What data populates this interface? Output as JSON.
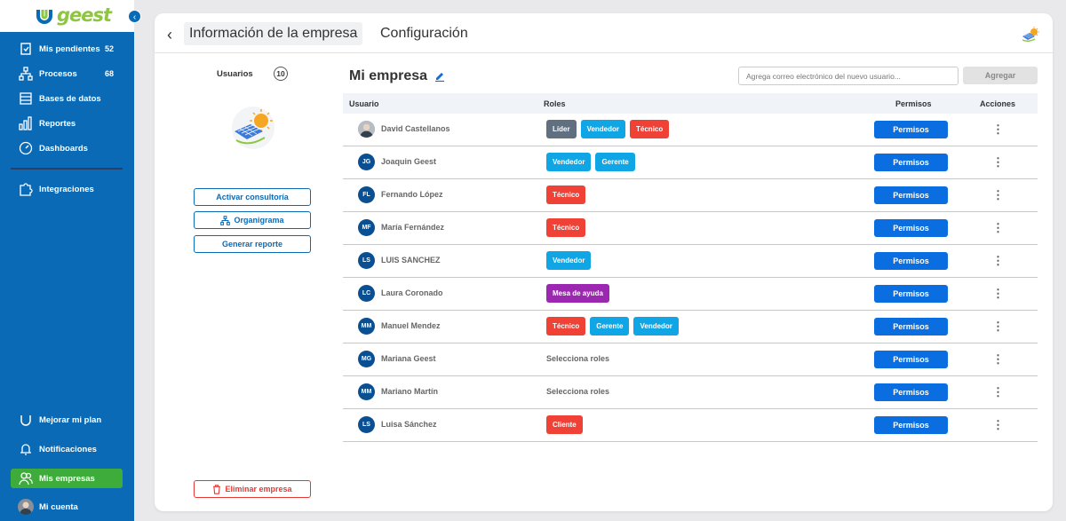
{
  "app": {
    "brand": "geest",
    "brand_color": "#8ec641",
    "sidebar_color": "#0a6ab5",
    "active_color": "#3dac3a"
  },
  "sidebar": {
    "items": [
      {
        "label": "Mis pendientes",
        "count": "52",
        "icon": "clipboard-icon"
      },
      {
        "label": "Procesos",
        "count": "68",
        "icon": "process-tree-icon"
      },
      {
        "label": "Bases de datos",
        "icon": "database-icon"
      },
      {
        "label": "Reportes",
        "icon": "bar-chart-icon"
      },
      {
        "label": "Dashboards",
        "icon": "gauge-icon"
      },
      {
        "label": "Integraciones",
        "icon": "puzzle-icon"
      }
    ],
    "bottom": [
      {
        "label": "Mejorar mi plan",
        "icon": "upgrade-icon"
      },
      {
        "label": "Notificaciones",
        "icon": "bell-icon"
      },
      {
        "label": "Mis empresas",
        "icon": "users-icon"
      },
      {
        "label": "Mi cuenta",
        "icon": "avatar"
      }
    ]
  },
  "header": {
    "tabs": [
      "Información de la empresa",
      "Configuración"
    ]
  },
  "left_panel": {
    "users_label": "Usuarios",
    "users_count": "10",
    "buttons": [
      "Activar consultoría",
      "Organigrama",
      "Generar reporte"
    ],
    "delete_label": "Eliminar empresa"
  },
  "main": {
    "title": "Mi empresa",
    "email_placeholder": "Agrega correo electrónico del nuevo usuario...",
    "add_label": "Agregar",
    "columns": [
      "Usuario",
      "Roles",
      "Permisos",
      "Acciones"
    ],
    "permissions_label": "Permisos",
    "roles_placeholder": "Selecciona roles",
    "role_colors": {
      "Líder": "#607080",
      "Vendedor": "#10a6e6",
      "Técnico": "#ef4136",
      "Gerente": "#10a6e6",
      "Mesa de ayuda": "#9c27b0",
      "Cliente": "#ef4136"
    },
    "rows": [
      {
        "initials": "",
        "name": "David Castellanos",
        "photo": true,
        "roles": [
          "Líder",
          "Vendedor",
          "Técnico"
        ]
      },
      {
        "initials": "JG",
        "name": "Joaquin Geest",
        "roles": [
          "Vendedor",
          "Gerente"
        ]
      },
      {
        "initials": "FL",
        "name": "Fernando López",
        "roles": [
          "Técnico"
        ]
      },
      {
        "initials": "MF",
        "name": "María Fernández",
        "roles": [
          "Técnico"
        ]
      },
      {
        "initials": "LS",
        "name": "LUIS SANCHEZ",
        "roles": [
          "Vendedor"
        ]
      },
      {
        "initials": "LC",
        "name": "Laura Coronado",
        "roles": [
          "Mesa de ayuda"
        ]
      },
      {
        "initials": "MM",
        "name": "Manuel Mendez",
        "roles": [
          "Técnico",
          "Gerente",
          "Vendedor"
        ]
      },
      {
        "initials": "MG",
        "name": "Mariana Geest",
        "roles": []
      },
      {
        "initials": "MM",
        "name": "Mariano Martín",
        "roles": []
      },
      {
        "initials": "LS",
        "name": "Luisa Sánchez",
        "roles": [
          "Cliente"
        ]
      }
    ]
  }
}
